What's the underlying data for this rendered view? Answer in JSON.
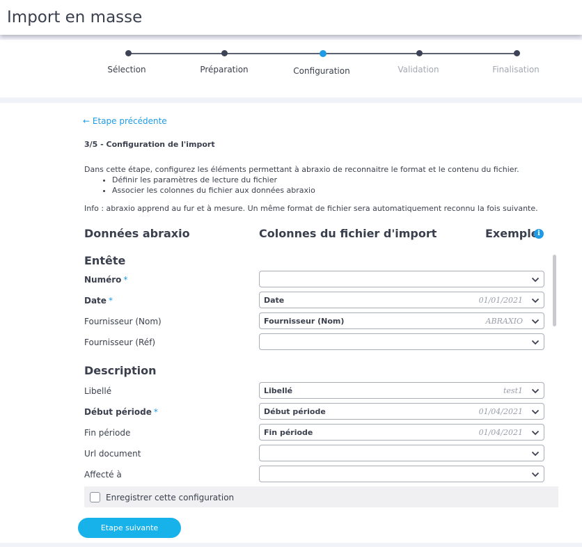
{
  "header": {
    "title": "Import en masse"
  },
  "stepper": {
    "steps": [
      {
        "label": "Sélection",
        "state": "done"
      },
      {
        "label": "Préparation",
        "state": "done"
      },
      {
        "label": "Configuration",
        "state": "active"
      },
      {
        "label": "Validation",
        "state": "pending"
      },
      {
        "label": "Finalisation",
        "state": "pending"
      }
    ]
  },
  "content": {
    "back_link": "← Etape précédente",
    "step_heading": "3/5 - Configuration de l'import",
    "description": "Dans cette étape, configurez les éléments permettant à abraxio de reconnaitre le format et le contenu du fichier.",
    "bullets": [
      "Définir les paramètres de lecture du fichier",
      "Associer les colonnes du fichier aux données abraxio"
    ],
    "info": "Info : abraxio apprend au fur et à mesure. Un même format de fichier sera automatiquement reconnu la fois suivante.",
    "columns": {
      "data": "Données abraxio",
      "file_columns": "Colonnes du fichier d'import",
      "example": "Exemple",
      "info_icon": "i"
    },
    "required_mark": "*",
    "sections": [
      {
        "title": "Entête",
        "fields": [
          {
            "label": "Numéro",
            "required": true,
            "value": "",
            "example": ""
          },
          {
            "label": "Date",
            "required": true,
            "value": "Date",
            "example": "01/01/2021"
          },
          {
            "label": "Fournisseur (Nom)",
            "required": false,
            "value": "Fournisseur (Nom)",
            "example": "ABRAXIO"
          },
          {
            "label": "Fournisseur (Réf)",
            "required": false,
            "value": "",
            "example": ""
          }
        ]
      },
      {
        "title": "Description",
        "fields": [
          {
            "label": "Libellé",
            "required": false,
            "value": "Libellé",
            "example": "test1"
          },
          {
            "label": "Début période",
            "required": true,
            "value": "Début période",
            "example": "01/04/2021"
          },
          {
            "label": "Fin période",
            "required": false,
            "value": "Fin période",
            "example": "01/04/2021"
          },
          {
            "label": "Url document",
            "required": false,
            "value": "",
            "example": ""
          },
          {
            "label": "Affecté à",
            "required": false,
            "value": "",
            "example": ""
          }
        ]
      }
    ],
    "save_config_label": "Enregistrer cette configuration",
    "next_button": "Etape suivante"
  },
  "colors": {
    "accent": "#1d9be6",
    "button": "#18b2ea",
    "text": "#3a3f4d",
    "muted": "#a4a8b3"
  },
  "icons": {
    "select_chevron": "chevron-down-icon",
    "info": "info-icon",
    "back": "arrow-left-icon"
  }
}
